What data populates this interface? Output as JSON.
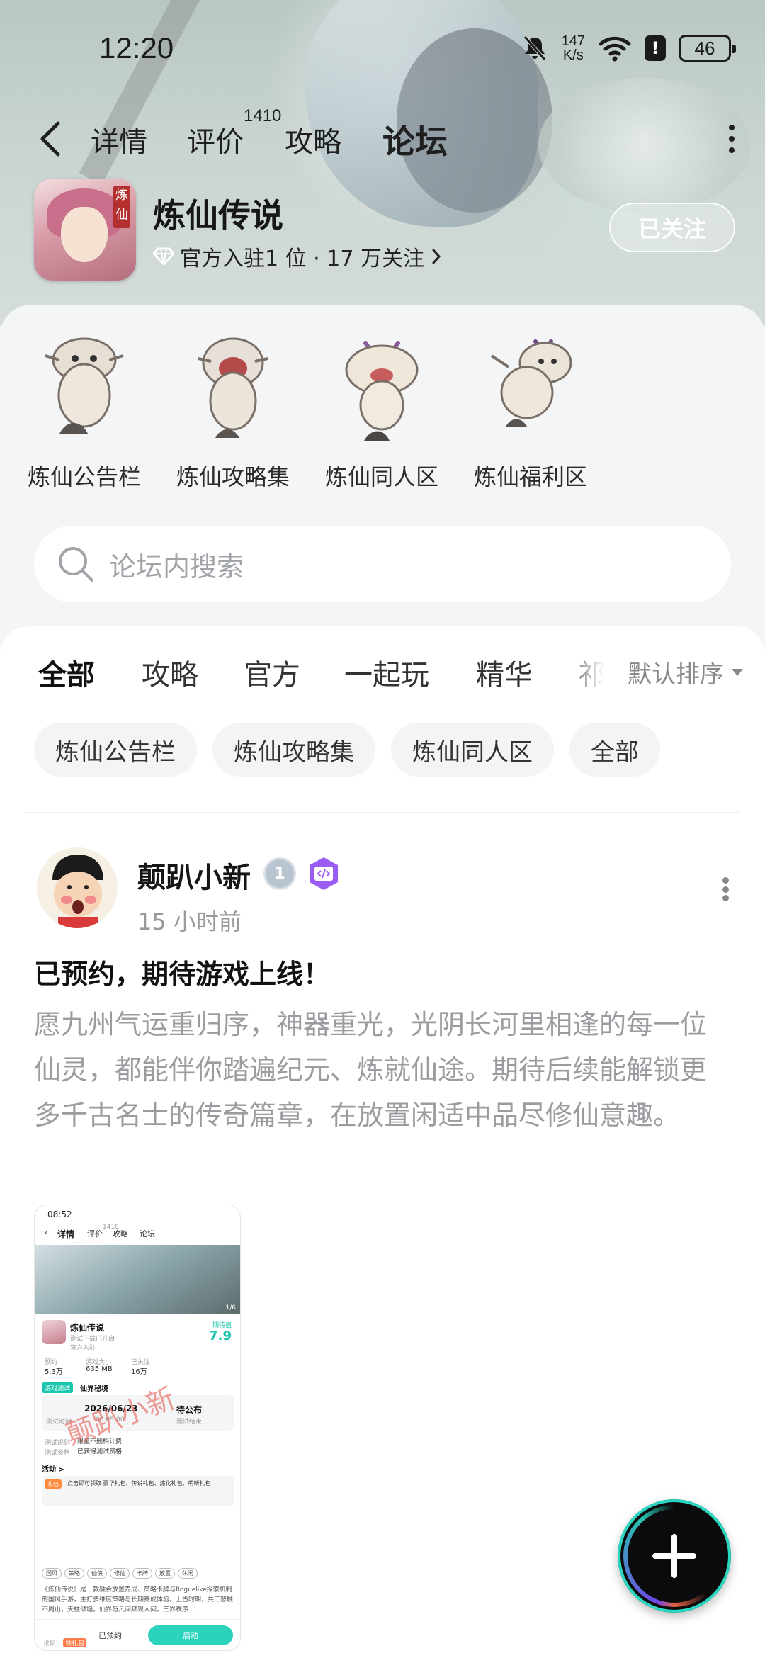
{
  "status_bar": {
    "time": "12:20",
    "net_speed_value": "147",
    "net_speed_unit": "K/s",
    "battery": "46",
    "alert": "!"
  },
  "nav": {
    "tabs": [
      {
        "label": "详情"
      },
      {
        "label": "评价"
      },
      {
        "label": "攻略"
      },
      {
        "label": "论坛"
      }
    ],
    "review_count": "1410",
    "active_tab": "论坛"
  },
  "game": {
    "name": "炼仙传说",
    "logo_text": "炼仙",
    "meta": "官方入驻1 位 · 17 万关注",
    "follow_label": "已关注"
  },
  "boards": [
    {
      "label": "炼仙公告栏"
    },
    {
      "label": "炼仙攻略集"
    },
    {
      "label": "炼仙同人区"
    },
    {
      "label": "炼仙福利区"
    }
  ],
  "search": {
    "placeholder": "论坛内搜索"
  },
  "categories": {
    "items": [
      "全部",
      "攻略",
      "官方",
      "一起玩",
      "精华",
      "祁"
    ],
    "sort_label": "默认排序"
  },
  "chips": [
    "炼仙公告栏",
    "炼仙攻略集",
    "炼仙同人区",
    "全部"
  ],
  "post": {
    "author": "颠趴小新",
    "level": "1",
    "time": "15 小时前",
    "title": "已预约，期待游戏上线！",
    "body": "愿九州气运重归序，神器重光，光阴长河里相逢的每一位仙灵，都能伴你踏遍纪元、炼就仙途。期待后续能解锁更多千古名士的传奇篇章，在放置闲适中品尽修仙意趣。"
  },
  "screenshot": {
    "time": "08:52",
    "tabs": [
      "详情",
      "评价",
      "攻略",
      "论坛"
    ],
    "review_count": "1410",
    "page_indicator": "1/6",
    "name": "炼仙传说",
    "sub": "测试下载已开启",
    "official": "官方入驻",
    "score_label": "期待值",
    "score": "7.9",
    "stats": [
      {
        "label": "预约",
        "value": "5.3万"
      },
      {
        "label": "游戏大小",
        "value": "635 MB"
      },
      {
        "label": "已关注",
        "value": "16万"
      }
    ],
    "test_badge": "游戏测试",
    "test_name": "仙界秘境",
    "test_time_label": "测试时间",
    "test_date": "2026/06/23",
    "test_clock": "00:05:00",
    "test_status": "待公布",
    "test_end": "测试结束",
    "rule1_label": "测试规则",
    "rule1": "限量不删档计费",
    "rule2_label": "测试资格",
    "rule2": "已获得测试资格",
    "activity": "活动 >",
    "gift_badge": "礼包",
    "gift_text": "点击即可领取 豪华礼包、传说礼包、炼化礼包、萌新礼包",
    "tags": [
      "国风",
      "策略",
      "仙侠",
      "修仙",
      "卡牌",
      "放置",
      "休闲"
    ],
    "desc": "《炼仙传说》是一款融合放置养成、策略卡牌与Roguelike探索机制的国风手游，主打多维度策略与长期养成体验。上古时期，共工怒触不周山，天柱倾塌，仙界与凡间频现人间，三界秩序...",
    "watermark": "颠趴小新",
    "bottom_left": "论坛",
    "bottom_gift": "领礼包",
    "reserved": "已预约",
    "start": "启动"
  }
}
